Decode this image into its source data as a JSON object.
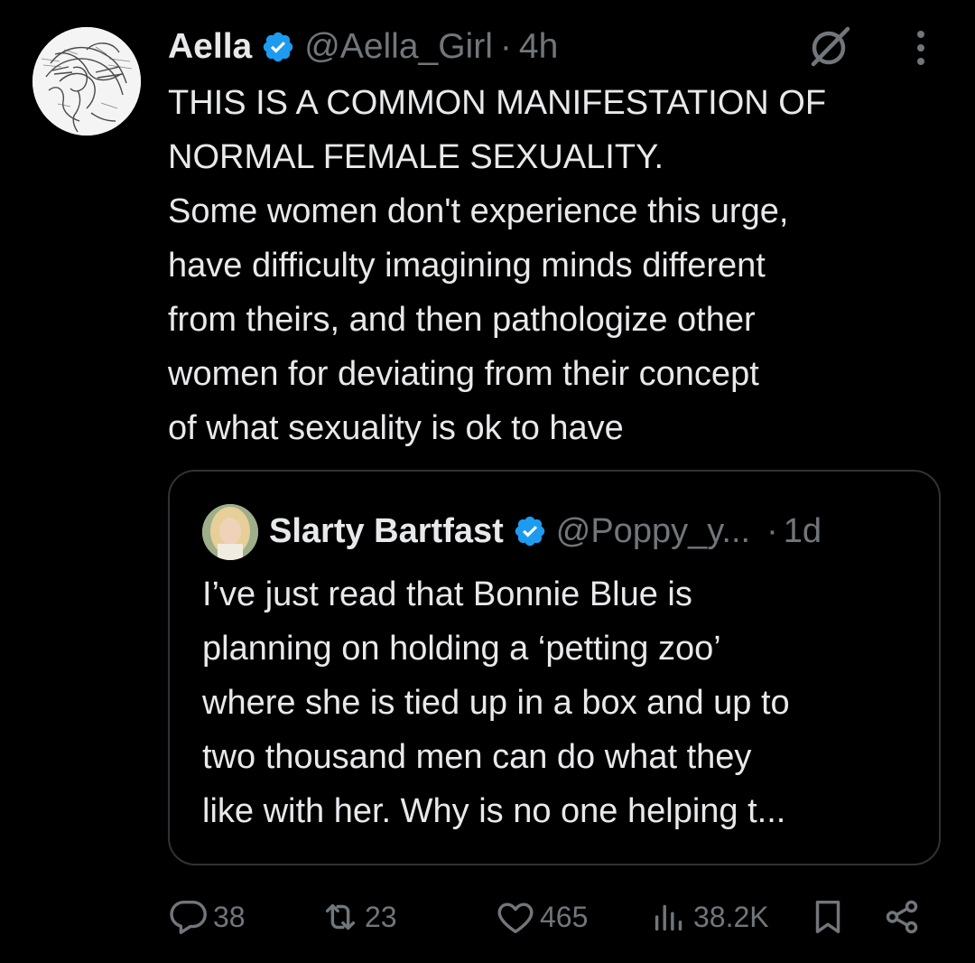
{
  "tweet": {
    "author_name": "Aella",
    "handle": "@Aella_Girl",
    "separator": "·",
    "time": "4h",
    "text_lines": [
      "THIS IS A COMMON MANIFESTATION OF",
      "NORMAL FEMALE SEXUALITY.",
      "Some women don't experience this urge,",
      "have difficulty imagining minds different",
      "from theirs, and then pathologize other",
      "women for deviating from their concept",
      "of what sexuality is ok to have"
    ],
    "icons": {
      "avatar": "sketch-portrait-avatar",
      "verified": "verified-badge-icon",
      "grok": "grok-slash-icon",
      "more": "more-vertical-icon"
    }
  },
  "quote": {
    "author_name": "Slarty Bartfast",
    "handle": "@Poppy_y...",
    "separator": "·",
    "time": "1d",
    "text_lines": [
      "I’ve just read that Bonnie Blue is",
      "planning on holding a ‘petting zoo’",
      "where she is tied up in a box and up to",
      "two thousand men can do what they",
      "like with her. Why is no one helping t..."
    ]
  },
  "actions": {
    "replies": "38",
    "reposts": "23",
    "likes": "465",
    "views": "38.2K",
    "icons": [
      "reply-icon",
      "repost-icon",
      "like-icon",
      "views-icon",
      "bookmark-icon",
      "share-icon"
    ]
  },
  "colors": {
    "background": "#000000",
    "text_primary": "#e7e9ea",
    "text_secondary": "#71767b",
    "border": "#2f3336",
    "verified_blue": "#1d9bf0"
  }
}
